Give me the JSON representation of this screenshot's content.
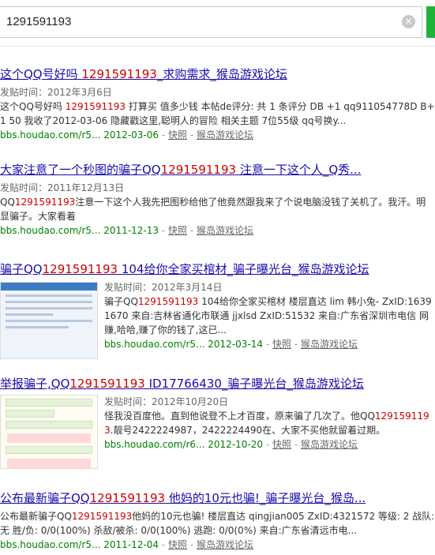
{
  "search": {
    "query": "1291591193"
  },
  "results": [
    {
      "title_pre": "这个QQ号好吗 ",
      "title_hl": "1291591193",
      "title_post": "_求购需求_猴岛游戏论坛",
      "date": "发贴时间：2012年3月6日",
      "desc_pre": "这个QQ号好吗 ",
      "desc_hl": "1291591193",
      "desc_post": " 打算买 值多少钱 本帖de评分: 共 1 条评分 DB +1 qq911054778D B+1 50 我收了2012-03-06 隐藏戳这里,聪明人的冒险 相关主题 7位55级 qq号换y...",
      "url": "bbs.houdao.com/r5...",
      "meta_date": "2012-03-06",
      "snapshot": "快照",
      "site": "猴岛游戏论坛"
    },
    {
      "title_pre": "大家注意了一个秒图的骗子QQ",
      "title_hl": "1291591193",
      "title_post": " 注意一下这个人_Q秀...",
      "date": "发贴时间：2011年12月13日",
      "desc_pre": "QQ",
      "desc_hl": "1291591193",
      "desc_post": "注意一下这个人我先把图秒给他了他竟然跟我来了个说电脑没钱了关机了。我汗。明显骗子。大家看着",
      "url": "bbs.houdao.com/r5...",
      "meta_date": "2011-12-13",
      "snapshot": "快照",
      "site": "猴岛游戏论坛"
    },
    {
      "title_pre": "骗子QQ",
      "title_hl": "1291591193",
      "title_post": " 104给你全家买棺材_骗子曝光台_猴岛游戏论坛",
      "date": "发贴时间：2012年3月14日",
      "desc_pre": "骗子QQ",
      "desc_hl": "1291591193",
      "desc_post": " 104给你全家买棺材 楼层直达 lim 韩小兔- ZxID:16391670 来自:吉林省通化市联通 jjxlsd ZxID:51532 来自:广东省深圳市电信 网赚,哈哈,赚了你的钱了,这已...",
      "url": "bbs.houdao.com/r5...",
      "meta_date": "2012-03-14",
      "snapshot": "快照",
      "site": "猴岛游戏论坛"
    },
    {
      "title_pre": "举报骗子,QQ",
      "title_hl": "1291591193",
      "title_post": " ID17766430_骗子曝光台_猴岛游戏论坛",
      "date": "发贴时间：2012年10月20日",
      "desc_pre": "怪我没百度他。直到他说登不上才百度，原来骗了几次了。他QQ",
      "desc_hl": "1291591193",
      "desc_post": ".靓号2422224987，2422224490在、大家不买他就留着过期。",
      "url": "bbs.houdao.com/r6...",
      "meta_date": "2012-10-20",
      "snapshot": "快照",
      "site": "猴岛游戏论坛"
    },
    {
      "title_pre": "公布最新骗子QQ",
      "title_hl": "1291591193",
      "title_post": " 他妈的10元也骗!_骗子曝光台_猴岛...",
      "date": "",
      "desc_pre": "公布最新骗子QQ",
      "desc_hl": "1291591193",
      "desc_post": "他妈的10元也骗! 楼层直达 qingjian005 ZxID:4321572 等级: 2 战队: 无 胜/负: 0/0(100%) 杀敌/被杀: 0/0(100%) 逃跑: 0/0(0%) 来自:广东省清远市电...",
      "url": "bbs.houdao.com/r5...",
      "meta_date": "2011-12-04",
      "snapshot": "快照",
      "site": "猴岛游戏论坛"
    }
  ]
}
